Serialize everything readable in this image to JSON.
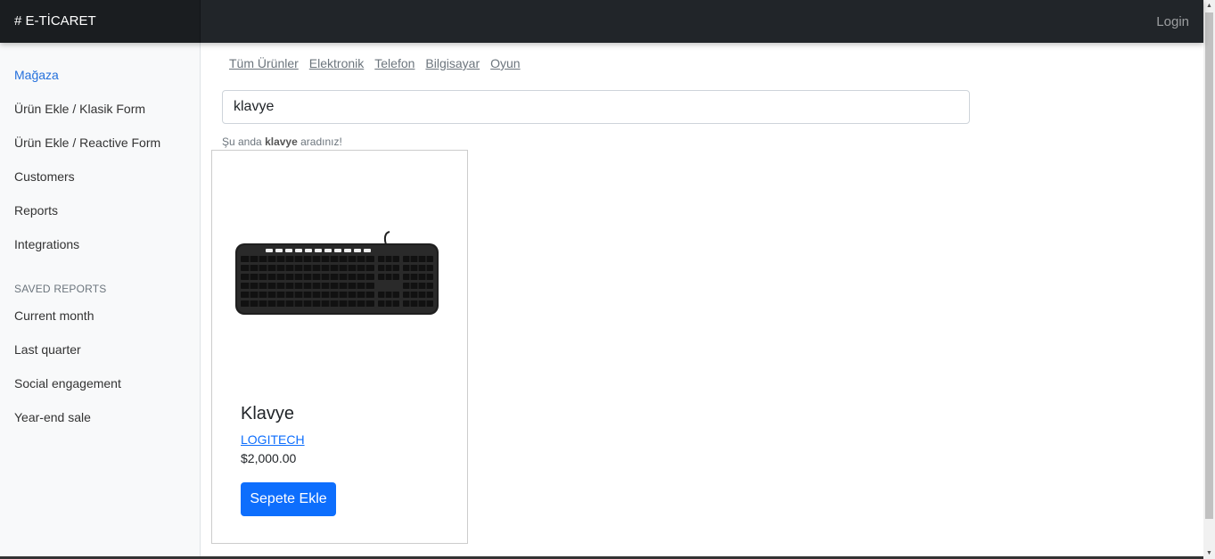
{
  "navbar": {
    "brand": "# E-TİCARET",
    "login_label": "Login"
  },
  "sidebar": {
    "items": [
      {
        "label": "Mağaza",
        "active": true
      },
      {
        "label": "Ürün Ekle / Klasik Form"
      },
      {
        "label": "Ürün Ekle / Reactive Form"
      },
      {
        "label": "Customers"
      },
      {
        "label": "Reports"
      },
      {
        "label": "Integrations"
      }
    ],
    "saved_heading": "SAVED REPORTS",
    "saved_items": [
      {
        "label": "Current month"
      },
      {
        "label": "Last quarter"
      },
      {
        "label": "Social engagement"
      },
      {
        "label": "Year-end sale"
      }
    ]
  },
  "categories": [
    "Tüm Ürünler",
    "Elektronik",
    "Telefon",
    "Bilgisayar",
    "Oyun"
  ],
  "search": {
    "value": "klavye",
    "hint_prefix": "Şu anda",
    "hint_term": "klavye",
    "hint_suffix": "aradınız!"
  },
  "product": {
    "title": "Klavye",
    "brand": "LOGITECH",
    "price": "$2,000.00",
    "add_button": "Sepete Ekle",
    "image_label": "keyboard product image"
  },
  "colors": {
    "navbar": "#212529",
    "brand_bg": "#1a1d20",
    "accent": "#0d6efd",
    "sidebar_active": "#2470dc"
  }
}
